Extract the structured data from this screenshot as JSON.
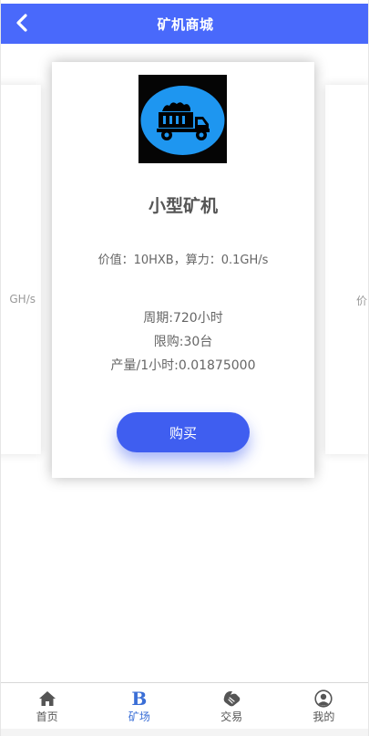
{
  "header": {
    "title": "矿机商城",
    "back_icon": "chevron-left-icon"
  },
  "carousel": {
    "left_peek_text": "GH/s",
    "right_peek_text": "价",
    "card": {
      "logo_icon": "dump-truck-icon",
      "title": "小型矿机",
      "value_line": "价值：10HXB，算力：0.1GH/s",
      "period": "周期:720小时",
      "limit": "限购:30台",
      "output": "产量/1小时:0.01875000",
      "buy_label": "购买"
    }
  },
  "tabbar": {
    "items": [
      {
        "label": "首页",
        "icon": "home-icon"
      },
      {
        "label": "矿场",
        "icon": "b-icon",
        "active": true
      },
      {
        "label": "交易",
        "icon": "handshake-icon"
      },
      {
        "label": "我的",
        "icon": "user-icon"
      }
    ]
  },
  "colors": {
    "header_bg": "#4969fb",
    "button_bg": "#3f5ef0",
    "active_tab": "#3a6ed6",
    "logo_circle": "#1e96f0"
  }
}
